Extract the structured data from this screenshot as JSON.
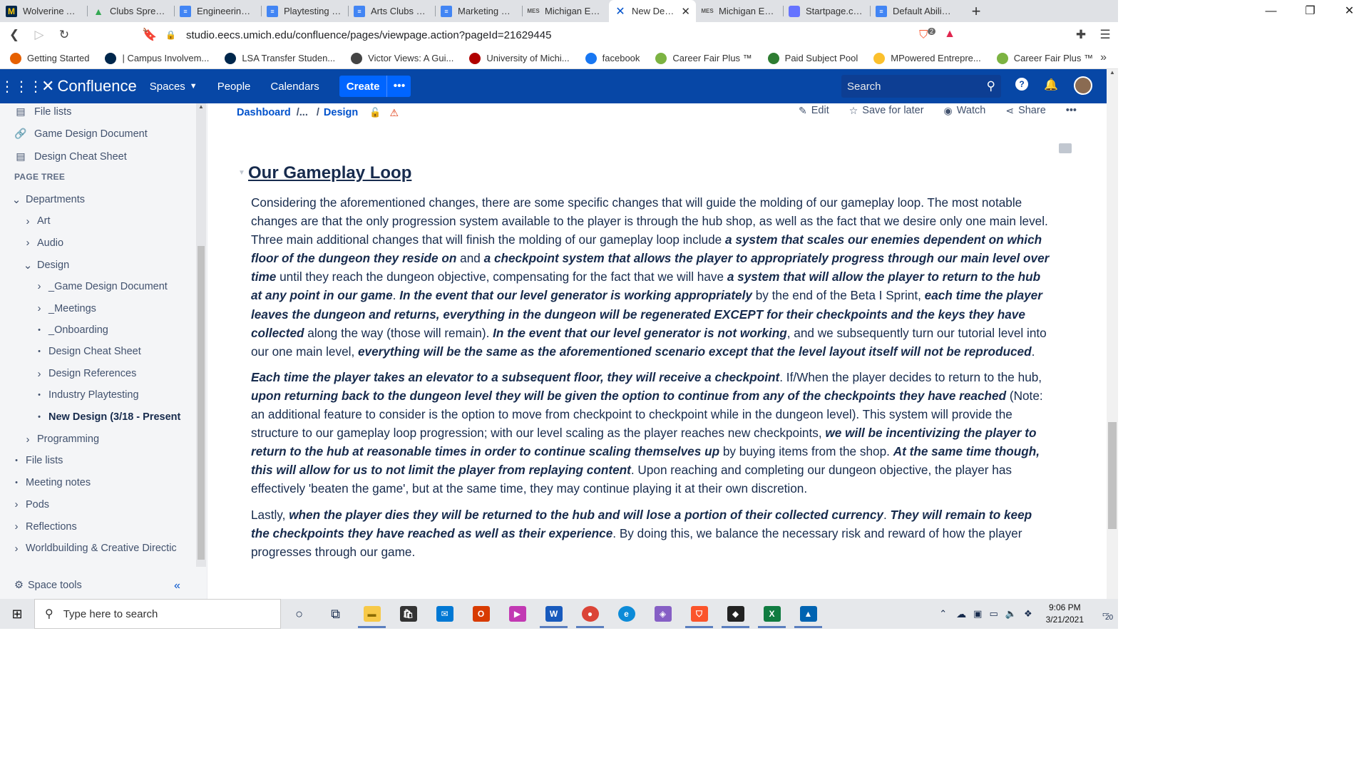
{
  "browser": {
    "tabs": [
      {
        "title": "Wolverine Access",
        "icon": "umich-icon"
      },
      {
        "title": "Clubs Spreadsheet",
        "icon": "google-drive-icon"
      },
      {
        "title": "Engineering Clubs",
        "icon": "google-docs-icon"
      },
      {
        "title": "Playtesting Ideas",
        "icon": "google-docs-icon"
      },
      {
        "title": "Arts Clubs Emails",
        "icon": "google-docs-icon"
      },
      {
        "title": "Marketing Emails",
        "icon": "google-docs-icon"
      },
      {
        "title": "Michigan Entrepreneurs",
        "icon": "mes-icon"
      },
      {
        "title": "New Design",
        "icon": "confluence-icon",
        "active": true
      },
      {
        "title": "Michigan Entrepreneurs",
        "icon": "mes-icon"
      },
      {
        "title": "Startpage.com",
        "icon": "startpage-icon"
      },
      {
        "title": "Default Abilities",
        "icon": "google-docs-icon"
      }
    ],
    "url": "studio.eecs.umich.edu/confluence/pages/viewpage.action?pageId=21629445",
    "shield_count": "2",
    "bookmarks": [
      {
        "label": "Getting Started",
        "color": "#e66000"
      },
      {
        "label": "| Campus Involvem...",
        "color": "#00274c"
      },
      {
        "label": "LSA Transfer Studen...",
        "color": "#00274c"
      },
      {
        "label": "Victor Views: A Gui...",
        "color": "#444444"
      },
      {
        "label": "University of Michi...",
        "color": "#b00000"
      },
      {
        "label": "facebook",
        "color": "#1877f2"
      },
      {
        "label": "Career Fair Plus ™",
        "color": "#7cb342"
      },
      {
        "label": "Paid Subject Pool",
        "color": "#2e7d32"
      },
      {
        "label": "MPowered Entrepre...",
        "color": "#fbc02d"
      },
      {
        "label": "Career Fair Plus ™",
        "color": "#7cb342"
      }
    ]
  },
  "confluence": {
    "logo": "Confluence",
    "nav": {
      "spaces": "Spaces",
      "people": "People",
      "calendars": "Calendars",
      "create": "Create"
    },
    "search_placeholder": "Search"
  },
  "sidebar": {
    "top_items": [
      {
        "label": "File lists",
        "icon": "file-list-icon"
      },
      {
        "label": "Game Design Document",
        "icon": "link-icon"
      },
      {
        "label": "Design Cheat Sheet",
        "icon": "document-icon"
      }
    ],
    "page_tree_heading": "PAGE TREE",
    "tree": [
      {
        "label": "Departments",
        "toggle": "expanded",
        "level": 0
      },
      {
        "label": "Art",
        "toggle": "collapsed",
        "level": 1
      },
      {
        "label": "Audio",
        "toggle": "collapsed",
        "level": 1
      },
      {
        "label": "Design",
        "toggle": "expanded",
        "level": 1
      },
      {
        "label": "_Game Design Document",
        "toggle": "collapsed",
        "level": 2
      },
      {
        "label": "_Meetings",
        "toggle": "collapsed",
        "level": 2
      },
      {
        "label": "_Onboarding",
        "toggle": "leaf",
        "level": 2
      },
      {
        "label": "Design Cheat Sheet",
        "toggle": "leaf",
        "level": 2
      },
      {
        "label": "Design References",
        "toggle": "collapsed",
        "level": 2
      },
      {
        "label": "Industry Playtesting",
        "toggle": "leaf",
        "level": 2
      },
      {
        "label": "New Design (3/18 - Present",
        "toggle": "leaf",
        "level": 2,
        "current": true
      },
      {
        "label": "Programming",
        "toggle": "collapsed",
        "level": 1
      },
      {
        "label": "File lists",
        "toggle": "leaf",
        "level": 0
      },
      {
        "label": "Meeting notes",
        "toggle": "leaf",
        "level": 0
      },
      {
        "label": "Pods",
        "toggle": "collapsed",
        "level": 0
      },
      {
        "label": "Reflections",
        "toggle": "collapsed",
        "level": 0
      },
      {
        "label": "Worldbuilding & Creative Directic",
        "toggle": "collapsed",
        "level": 0
      }
    ],
    "space_tools": "Space tools"
  },
  "page": {
    "breadcrumb": {
      "dashboard": "Dashboard",
      "ellipsis": "/...",
      "slash": "/",
      "design": "Design"
    },
    "actions": {
      "edit": "Edit",
      "save": "Save for later",
      "watch": "Watch",
      "share": "Share"
    },
    "heading": "Our Gameplay Loop",
    "paragraphs": [
      [
        {
          "t": "Considering the aforementioned changes, there are some specific changes that will guide the molding of our gameplay loop. The most notable changes are that the only progression system available to the player is through the hub shop, as well as the fact that we desire only one main level. Three main additional changes that will finish the molding of our gameplay loop include "
        },
        {
          "t": "a system that scales our enemies dependent on which floor of the dungeon they reside on",
          "b": true
        },
        {
          "t": " and "
        },
        {
          "t": "a checkpoint system that allows the player to appropriately progress through our main level over time",
          "b": true
        },
        {
          "t": " until they reach the dungeon objective, compensating for the fact that we will have "
        },
        {
          "t": "a system that will allow the player to return to the hub at any point in our game",
          "b": true
        },
        {
          "t": ". "
        },
        {
          "t": "In the event that our level generator is working appropriately",
          "b": true
        },
        {
          "t": " by the end of the Beta I Sprint, "
        },
        {
          "t": "each time the player leaves the dungeon and returns, everything in the dungeon will be regenerated EXCEPT for their checkpoints and the keys they have collected",
          "b": true
        },
        {
          "t": " along the way (those will remain). "
        },
        {
          "t": "In the event that our level generator is not working",
          "b": true
        },
        {
          "t": ", and we subsequently turn our tutorial level into our one main level, "
        },
        {
          "t": "everything will be the same as the aforementioned scenario except that the level layout itself will not be reproduced",
          "b": true
        },
        {
          "t": "."
        }
      ],
      [
        {
          "t": "Each time the player takes an elevator to a subsequent floor, they will receive a checkpoint",
          "b": true
        },
        {
          "t": ". If/When the player decides to return to the hub, "
        },
        {
          "t": "upon returning back to the dungeon level they will be given the option to continue from any of the checkpoints they have reached",
          "b": true
        },
        {
          "t": " (Note: an additional feature to consider is the option to move from checkpoint to checkpoint while in the dungeon level). This system will provide the structure to our gameplay loop progression; with our level scaling as the player reaches new checkpoints, "
        },
        {
          "t": "we will be incentivizing the player to return to the hub at reasonable times in order to continue scaling themselves up",
          "b": true
        },
        {
          "t": " by buying items from the shop. "
        },
        {
          "t": "At the same time though, this will allow for us to not limit the player from replaying content",
          "b": true
        },
        {
          "t": ". Upon reaching and completing our dungeon objective, the player has effectively 'beaten the game', but at the same time, they may continue playing it at their own discretion."
        }
      ],
      [
        {
          "t": "Lastly, "
        },
        {
          "t": "when the player dies they will be returned to the hub and will lose a portion of their collected currency",
          "b": true
        },
        {
          "t": ". "
        },
        {
          "t": "They will remain to keep the checkpoints they have reached as well as their experience",
          "b": true
        },
        {
          "t": ". By doing this, we balance the necessary risk and reward of how the player progresses through our game."
        }
      ]
    ]
  },
  "taskbar": {
    "search_placeholder": "Type here to search",
    "time": "9:06 PM",
    "date": "3/21/2021",
    "notifications": "20"
  }
}
